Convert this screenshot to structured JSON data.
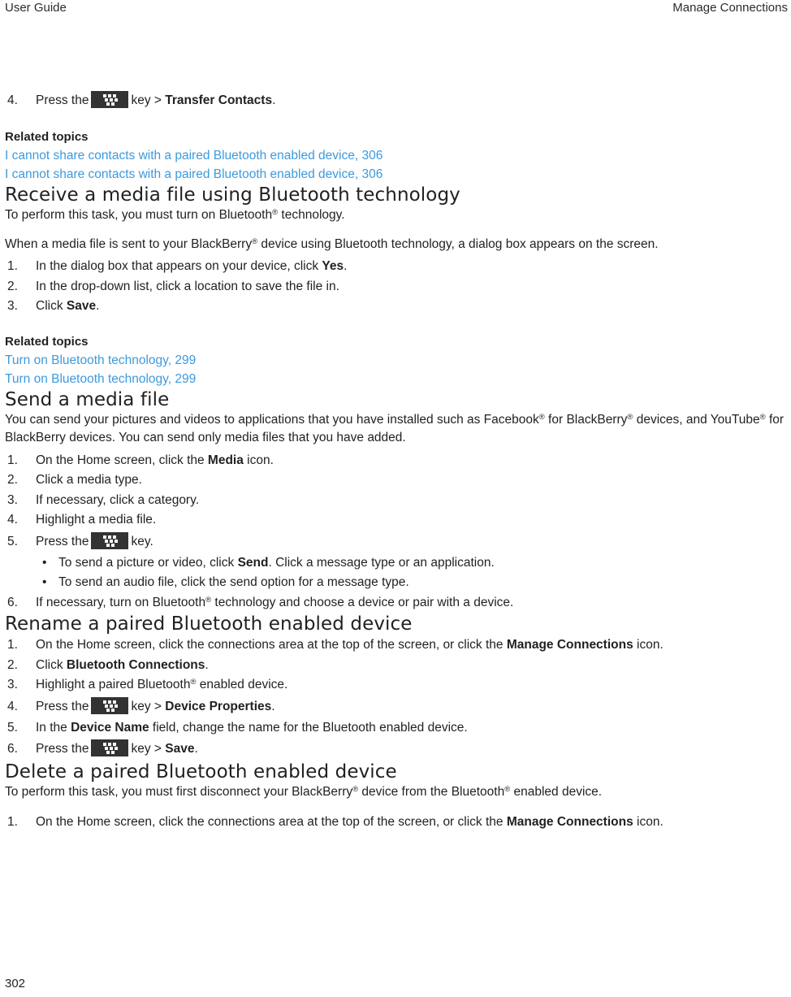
{
  "running_head": {
    "left": "User Guide",
    "right": "Manage Connections"
  },
  "folio": "302",
  "icons": {
    "menu_key": "blackberry-menu-key-icon"
  },
  "colors": {
    "link": "#3c9ade",
    "text": "#231f20",
    "menu_key_bg": "#333333"
  },
  "continued_step": {
    "num": "4.",
    "before_key": "Press the",
    "after_key_prefix": "key > ",
    "after_key_bold": "Transfer Contacts",
    "after_key_suffix": "."
  },
  "related_topics_1": {
    "title": "Related topics",
    "links": [
      "I cannot share contacts with a paired Bluetooth enabled device, 306",
      "I cannot share contacts with a paired Bluetooth enabled device, 306"
    ]
  },
  "section_receive": {
    "heading": "Receive a media file using Bluetooth technology",
    "para_prereq_a": "To perform this task, you must turn on Bluetooth",
    "para_prereq_b": " technology.",
    "para_intro_a": "When a media file is sent to your BlackBerry",
    "para_intro_b": " device using Bluetooth technology, a dialog box appears on the screen.",
    "steps": [
      {
        "num": "1.",
        "a": "In the dialog box that appears on your device, click ",
        "bold": "Yes",
        "b": "."
      },
      {
        "num": "2.",
        "a": "In the drop-down list, click a location to save the file in.",
        "bold": "",
        "b": ""
      },
      {
        "num": "3.",
        "a": "Click ",
        "bold": "Save",
        "b": "."
      }
    ]
  },
  "related_topics_2": {
    "title": "Related topics",
    "links": [
      "Turn on Bluetooth technology, 299",
      "Turn on Bluetooth technology, 299"
    ]
  },
  "section_send": {
    "heading": "Send a media file",
    "para_a": "You can send your pictures and videos to applications that you have installed such as Facebook",
    "para_b": " for BlackBerry",
    "para_c": " devices, and YouTube",
    "para_d": " for BlackBerry devices. You can send only media files that you have added.",
    "steps": [
      {
        "num": "1.",
        "a": "On the Home screen, click the ",
        "bold": "Media",
        "b": " icon."
      },
      {
        "num": "2.",
        "a": "Click a media type.",
        "bold": "",
        "b": ""
      },
      {
        "num": "3.",
        "a": "If necessary, click a category.",
        "bold": "",
        "b": ""
      },
      {
        "num": "4.",
        "a": "Highlight a media file.",
        "bold": "",
        "b": ""
      }
    ],
    "step5": {
      "num": "5.",
      "before_key": "Press the",
      "after_key": "key."
    },
    "substeps": [
      {
        "a": "To send a picture or video, click ",
        "bold": "Send",
        "b": ". Click a message type or an application."
      },
      {
        "a": "To send an audio file, click the send option for a message type.",
        "bold": "",
        "b": ""
      }
    ],
    "step6": {
      "num": "6.",
      "a": "If necessary, turn on Bluetooth",
      "b": " technology and choose a device or pair with a device."
    }
  },
  "section_rename": {
    "heading": "Rename a paired Bluetooth enabled device",
    "steps": [
      {
        "num": "1.",
        "a": "On the Home screen, click the connections area at the top of the screen, or click the ",
        "bold": "Manage Connections",
        "b": " icon."
      },
      {
        "num": "2.",
        "a": "Click ",
        "bold": "Bluetooth Connections",
        "b": "."
      }
    ],
    "step3": {
      "num": "3.",
      "a": "Highlight a paired Bluetooth",
      "b": " enabled device."
    },
    "step4": {
      "num": "4.",
      "before_key": "Press the",
      "after_key_prefix": "key > ",
      "after_key_bold": "Device Properties",
      "after_key_suffix": "."
    },
    "step5": {
      "num": "5.",
      "a": "In the ",
      "bold": "Device Name",
      "b": " field, change the name for the Bluetooth enabled device."
    },
    "step6": {
      "num": "6.",
      "before_key": "Press the",
      "after_key_prefix": "key > ",
      "after_key_bold": "Save",
      "after_key_suffix": "."
    }
  },
  "section_delete": {
    "heading": "Delete a paired Bluetooth enabled device",
    "para_a": "To perform this task, you must first disconnect your BlackBerry",
    "para_b": " device from the Bluetooth",
    "para_c": " enabled device.",
    "steps": [
      {
        "num": "1.",
        "a": "On the Home screen, click the connections area at the top of the screen, or click the ",
        "bold": "Manage Connections",
        "b": " icon."
      }
    ]
  }
}
